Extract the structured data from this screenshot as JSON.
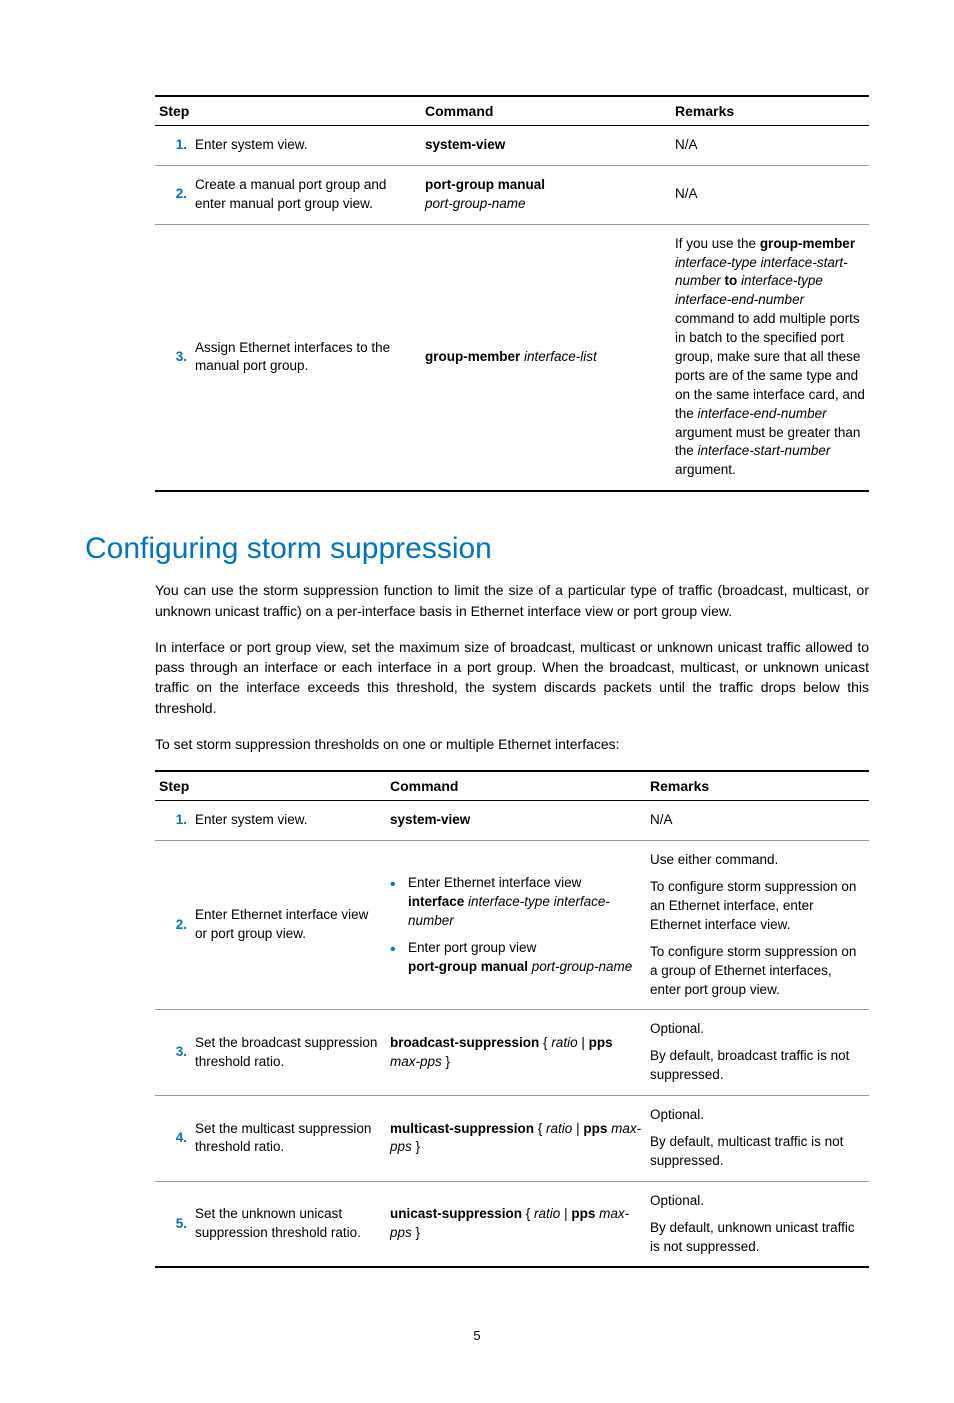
{
  "table1": {
    "headers": {
      "step": "Step",
      "command": "Command",
      "remarks": "Remarks"
    },
    "rows": [
      {
        "num": "1.",
        "step": "Enter system view.",
        "cmd_bold": "system-view",
        "remarks_na": "N/A"
      },
      {
        "num": "2.",
        "step": "Create a manual port group and enter manual port group view.",
        "cmd_bold": "port-group manual",
        "cmd_ital": "port-group-name",
        "remarks_na": "N/A"
      },
      {
        "num": "3.",
        "step": "Assign Ethernet interfaces to the manual port group.",
        "cmd_bold": "group-member",
        "cmd_ital": " interface-list",
        "remarks": {
          "p1a": "If you use the ",
          "p1b": "group-member",
          "p1c": " ",
          "p1d": "interface-type interface-start-number",
          "p1e": " ",
          "p1f": "to",
          "p1g": " ",
          "p1h": "interface-type interface-end-number",
          "p1i": " command to add multiple ports in batch to the specified port group, make sure that all these ports are of the same type and on the same interface card, and the ",
          "p1j": "interface-end-number",
          "p1k": " argument must be greater than the ",
          "p1l": "interface-start-number",
          "p1m": " argument."
        }
      }
    ]
  },
  "section": {
    "title": "Configuring storm suppression",
    "para1": "You can use the storm suppression function to limit the size of a particular type of traffic (broadcast, multicast, or unknown unicast traffic) on a per-interface basis in Ethernet interface view or port group view.",
    "para2": "In interface or port group view, set the maximum size of broadcast, multicast or unknown unicast traffic allowed to pass through an interface or each interface in a port group. When the broadcast, multicast, or unknown unicast traffic on the interface exceeds this threshold, the system discards packets until the traffic drops below this threshold.",
    "para3": "To set storm suppression thresholds on one or multiple Ethernet interfaces:"
  },
  "table2": {
    "headers": {
      "step": "Step",
      "command": "Command",
      "remarks": "Remarks"
    },
    "rows": [
      {
        "num": "1.",
        "step": "Enter system view.",
        "cmd_bold": "system-view",
        "remarks_na": "N/A"
      },
      {
        "num": "2.",
        "step": "Enter Ethernet interface view or port group view.",
        "bullets": [
          {
            "line1": "Enter Ethernet interface view",
            "b": "interface",
            "i": " interface-type interface-number"
          },
          {
            "line1": "Enter port group view",
            "b": "port-group manual",
            "i": " port-group-name"
          }
        ],
        "remarks": {
          "p1": "Use either command.",
          "p2": "To configure storm suppression on an Ethernet interface, enter Ethernet interface view.",
          "p3": "To configure storm suppression on a group of Ethernet interfaces, enter port group view."
        }
      },
      {
        "num": "3.",
        "step": "Set the broadcast suppression threshold ratio.",
        "cmd_b1": "broadcast-suppression",
        "cmd_t1": " { ",
        "cmd_i1": "ratio",
        "cmd_t2": " | ",
        "cmd_b2": "pps",
        "cmd_t3": " ",
        "cmd_i2": "max-pps",
        "cmd_t4": " }",
        "remarks": {
          "p1": "Optional.",
          "p2": "By default, broadcast traffic is not suppressed."
        }
      },
      {
        "num": "4.",
        "step": "Set the multicast suppression threshold ratio.",
        "cmd_b1": "multicast-suppression",
        "cmd_t1": " { ",
        "cmd_i1": "ratio",
        "cmd_t2": " | ",
        "cmd_b2": "pps",
        "cmd_t3": " ",
        "cmd_i2": "max-pps",
        "cmd_t4": " }",
        "remarks": {
          "p1": "Optional.",
          "p2": "By default, multicast traffic is not suppressed."
        }
      },
      {
        "num": "5.",
        "step": "Set the unknown unicast suppression threshold ratio.",
        "cmd_b1": "unicast-suppression",
        "cmd_t1": " { ",
        "cmd_i1": "ratio",
        "cmd_t2": " | ",
        "cmd_b2": "pps",
        "cmd_t3": " ",
        "cmd_i2": "max-pps",
        "cmd_t4": " }",
        "remarks": {
          "p1": "Optional.",
          "p2": "By default, unknown unicast traffic is not suppressed."
        }
      }
    ]
  },
  "page_number": "5"
}
